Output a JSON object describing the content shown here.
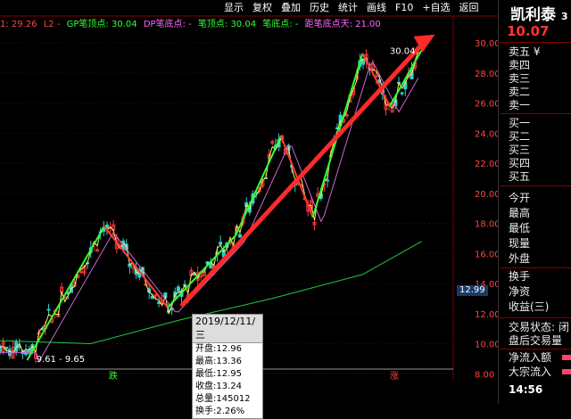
{
  "legend": {
    "l1": "1: 29.26",
    "l2": "L2 -",
    "gp": "GP笔顶点: 30.04",
    "dp": "DP笔底点: -",
    "bd": "笔顶点: 30.04",
    "bb": "笔底点: -",
    "dist": "距笔底点天: 21.00"
  },
  "toolbar": [
    "显示",
    "复权",
    "叠加",
    "历史",
    "统计",
    "画线",
    "F10",
    "+自选",
    "返回"
  ],
  "stock": {
    "name": "凯利泰",
    "suffix": "3",
    "price": "10.07"
  },
  "sidebar": {
    "sell": [
      "卖五",
      "卖四",
      "卖三",
      "卖二",
      "卖一"
    ],
    "sell_extra": "¥",
    "buy": [
      "买一",
      "买二",
      "买三",
      "买四",
      "买五"
    ],
    "stats": [
      "今开",
      "最高",
      "最低",
      "现量",
      "外盘"
    ],
    "stats2": [
      "换手",
      "净资",
      "收益(三)"
    ],
    "status": [
      "交易状态: 闭",
      "盘后交易量"
    ],
    "flow": [
      "净流入额",
      "大宗流入"
    ],
    "time": "14:56"
  },
  "tooltip": {
    "date": "2019/12/11/三",
    "rows": [
      "开盘:12.96",
      "最高:13.36",
      "最低:12.95",
      "收盘:13.24",
      "总量:145012",
      "换手:2.26%"
    ]
  },
  "chart_data": {
    "type": "candlestick",
    "y_ticks": [
      8,
      10,
      12,
      14,
      16,
      18,
      20,
      22,
      24,
      26,
      28,
      30
    ],
    "ylim": [
      7.6,
      30.6
    ],
    "current_price_tag": "12.99",
    "top_label": "30.04",
    "low_label": "9.61 - 9.65",
    "markers": [
      "跌",
      "涨"
    ],
    "zigzag_up": [
      [
        0.06,
        8.9
      ],
      [
        0.23,
        17.8
      ],
      [
        0.37,
        12.4
      ],
      [
        0.52,
        17.2
      ],
      [
        0.62,
        23.8
      ],
      [
        0.69,
        18.4
      ],
      [
        0.8,
        29.3
      ],
      [
        0.86,
        25.8
      ],
      [
        0.93,
        29.5
      ]
    ],
    "trend_arrow": [
      [
        0.4,
        12.5
      ],
      [
        0.94,
        30.2
      ]
    ],
    "ma_long": [
      [
        0,
        10.2
      ],
      [
        0.2,
        10.0
      ],
      [
        0.4,
        11.6
      ],
      [
        0.6,
        13.0
      ],
      [
        0.8,
        14.6
      ],
      [
        0.93,
        16.8
      ]
    ]
  },
  "colors": {
    "up": "#ff3b3b",
    "down": "#3cc",
    "green": "#33ff33",
    "red_arrow": "#ff2a2a",
    "ma_long": "#22cc44",
    "ma_mid": "#cc66cc",
    "ma_short": "#ffee66"
  }
}
